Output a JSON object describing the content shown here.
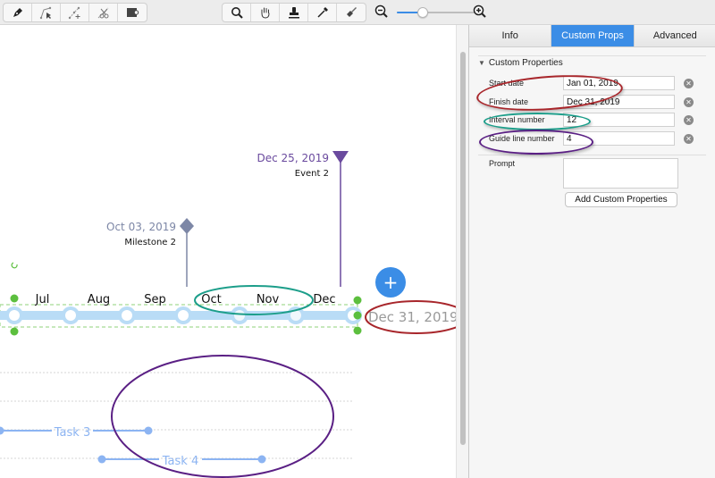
{
  "toolbar": {
    "left_tools": [
      {
        "icon": "pen-tool-icon"
      },
      {
        "icon": "bezier-select-icon"
      },
      {
        "icon": "add-point-icon"
      },
      {
        "icon": "cut-path-icon"
      },
      {
        "icon": "frame-tool-icon"
      }
    ],
    "right_tools": [
      {
        "icon": "magnifier-icon"
      },
      {
        "icon": "hand-pan-icon"
      },
      {
        "icon": "stamp-icon"
      },
      {
        "icon": "eyedropper-icon"
      },
      {
        "icon": "paint-brush-icon"
      }
    ],
    "zoom": {
      "zoom_out_icon": "zoom-out-icon",
      "zoom_in_icon": "zoom-in-icon",
      "level_fraction": 0.3
    }
  },
  "canvas": {
    "months": [
      "Jul",
      "Aug",
      "Sep",
      "Oct",
      "Nov",
      "Dec"
    ],
    "end_date_label": "Dec 31, 2019",
    "add_button_label": "+",
    "milestone": {
      "date": "Oct 03, 2019",
      "name": "Milestone 2"
    },
    "event": {
      "date": "Dec 25, 2019",
      "name": "Event 2"
    },
    "tasks": [
      {
        "name": "Task 3"
      },
      {
        "name": "Task 4"
      }
    ],
    "colors": {
      "timeline": "#b9dcf6",
      "milestone": "#7d87a6",
      "event": "#6a4a9e",
      "task": "#8cb4f2",
      "selection": "#5cbf3e",
      "add_button": "#3b8de6"
    }
  },
  "panel": {
    "tabs": [
      {
        "label": "Info",
        "active": false
      },
      {
        "label": "Custom Props",
        "active": true
      },
      {
        "label": "Advanced",
        "active": false
      }
    ],
    "section_title": "Custom Properties",
    "properties": [
      {
        "label": "Start date",
        "value": "Jan 01, 2019"
      },
      {
        "label": "Finish date",
        "value": "Dec 31, 2019"
      },
      {
        "label": "Interval number",
        "value": "12"
      },
      {
        "label": "Guide line number",
        "value": "4"
      }
    ],
    "prompt_label": "Prompt",
    "prompt_value": "",
    "add_button_label": "Add Custom Properties"
  },
  "annotations": {
    "red": "#a8262b",
    "teal": "#1c9e8a",
    "purple": "#5a1f84"
  }
}
